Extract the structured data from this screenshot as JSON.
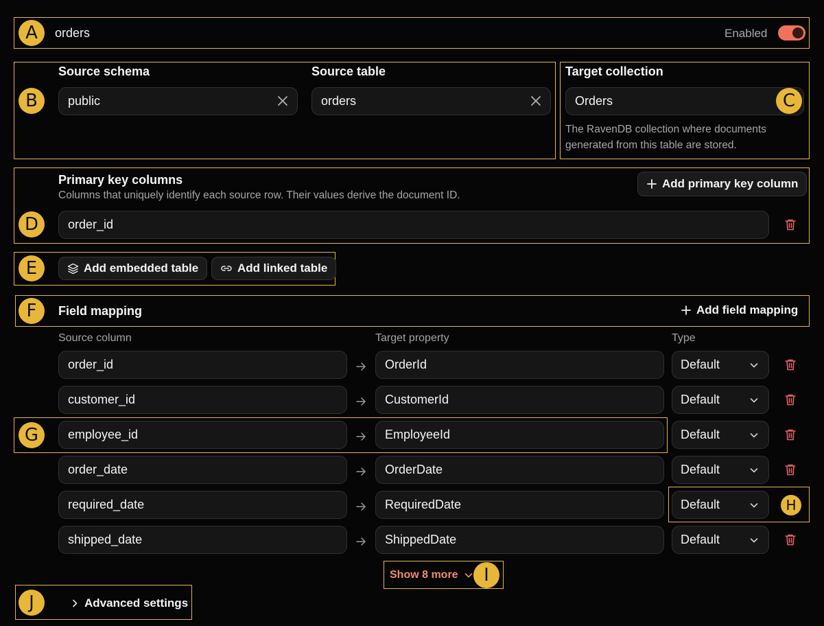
{
  "table": {
    "name": "orders",
    "status_label": "Enabled",
    "enabled": true
  },
  "source": {
    "schema_label": "Source schema",
    "schema_value": "public",
    "table_label": "Source table",
    "table_value": "orders"
  },
  "target": {
    "label": "Target collection",
    "value": "Orders",
    "help": "The RavenDB collection where documents generated from this table are stored."
  },
  "primary_keys": {
    "title": "Primary key columns",
    "description": "Columns that uniquely identify each source row. Their values derive the document ID.",
    "add_label": "Add primary key column",
    "items": [
      "order_id"
    ]
  },
  "relations": {
    "embedded_label": "Add embedded table",
    "linked_label": "Add linked table"
  },
  "field_mapping": {
    "title": "Field mapping",
    "add_label": "Add field mapping",
    "col_source": "Source column",
    "col_target": "Target property",
    "col_type": "Type",
    "rows": [
      {
        "source": "order_id",
        "target": "OrderId",
        "type": "Default"
      },
      {
        "source": "customer_id",
        "target": "CustomerId",
        "type": "Default"
      },
      {
        "source": "employee_id",
        "target": "EmployeeId",
        "type": "Default"
      },
      {
        "source": "order_date",
        "target": "OrderDate",
        "type": "Default"
      },
      {
        "source": "required_date",
        "target": "RequiredDate",
        "type": "Default"
      },
      {
        "source": "shipped_date",
        "target": "ShippedDate",
        "type": "Default"
      }
    ],
    "show_more_label": "Show 8 more"
  },
  "advanced": {
    "label": "Advanced settings"
  },
  "markers": [
    "A",
    "B",
    "C",
    "D",
    "E",
    "F",
    "G",
    "H",
    "I",
    "J"
  ],
  "colors": {
    "accent": "#e8b73a",
    "toggle_on": "#f0725c",
    "danger": "#e35d68",
    "link": "#f08a72"
  }
}
